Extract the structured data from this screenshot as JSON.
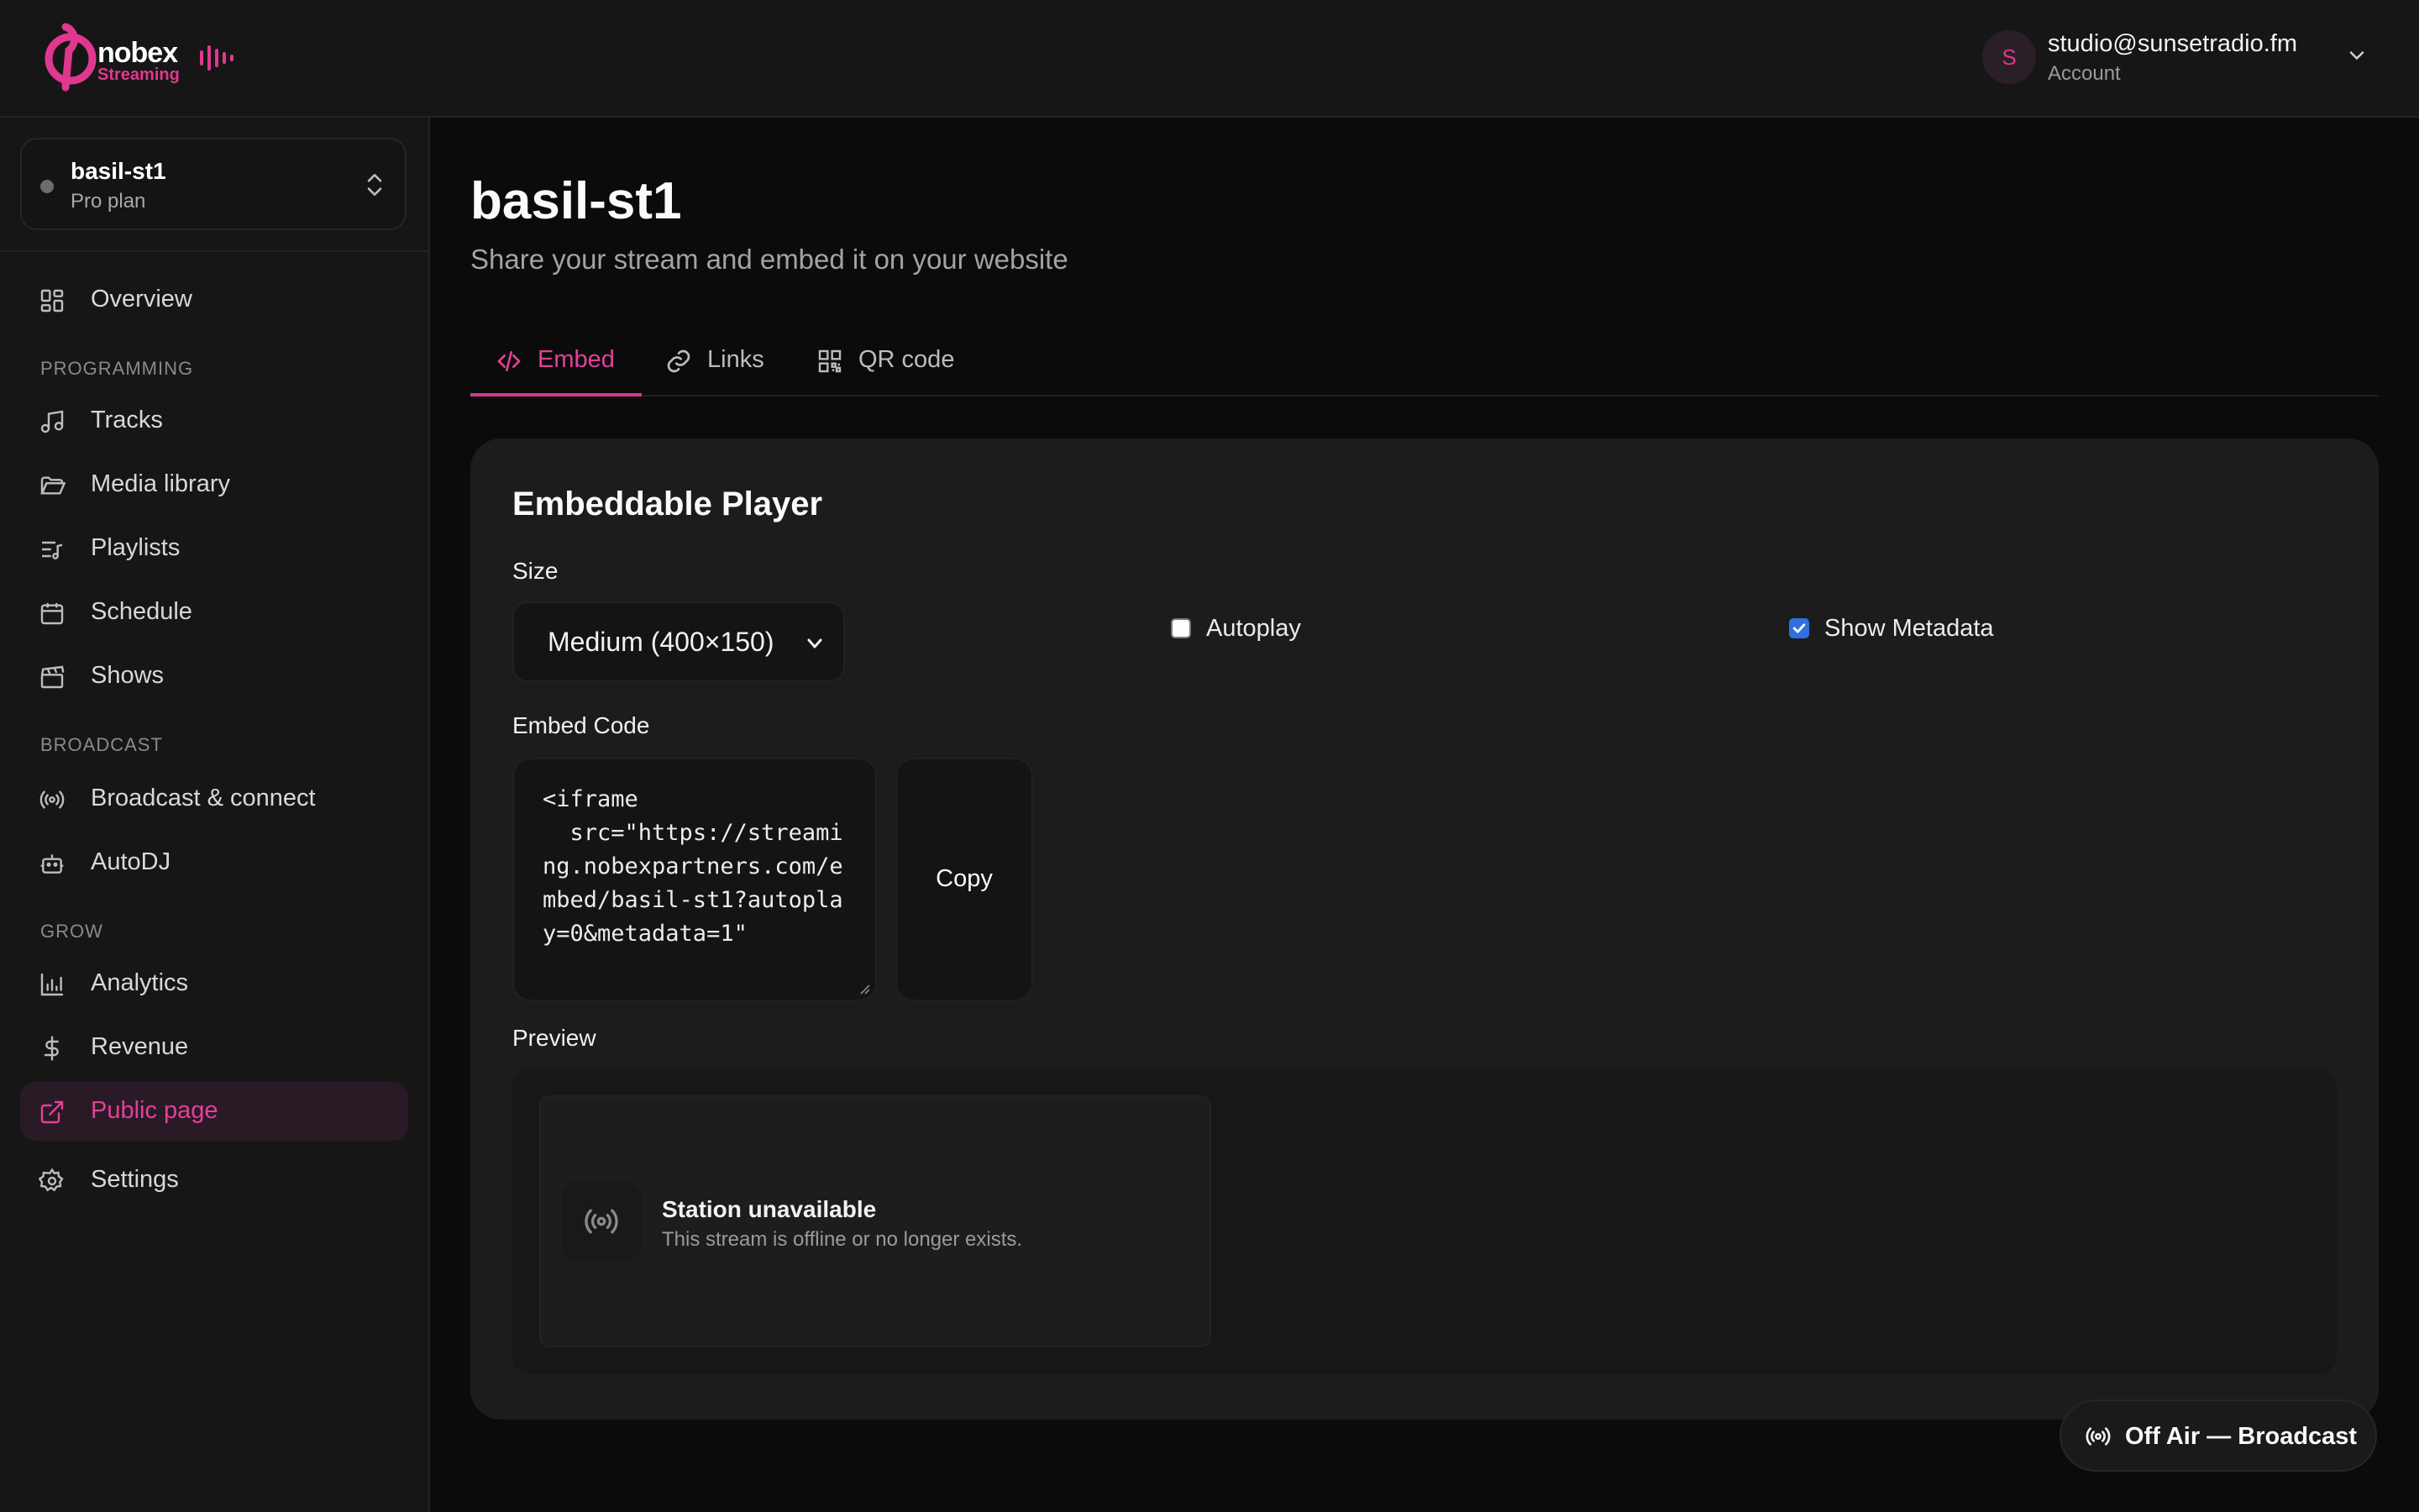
{
  "brand": {
    "name": "nobex",
    "sub": "Streaming",
    "accent": "#e0388f"
  },
  "account": {
    "initial": "S",
    "email": "studio@sunsetradio.fm",
    "label": "Account"
  },
  "station": {
    "name": "basil-st1",
    "plan": "Pro plan"
  },
  "nav": {
    "overview": "Overview",
    "section_programming": "PROGRAMMING",
    "tracks": "Tracks",
    "media_library": "Media library",
    "playlists": "Playlists",
    "schedule": "Schedule",
    "shows": "Shows",
    "section_broadcast": "BROADCAST",
    "broadcast_connect": "Broadcast & connect",
    "autodj": "AutoDJ",
    "section_grow": "GROW",
    "analytics": "Analytics",
    "revenue": "Revenue",
    "public_page": "Public page",
    "settings": "Settings",
    "active": "public_page"
  },
  "page": {
    "title": "basil-st1",
    "subtitle": "Share your stream and embed it on your website"
  },
  "tabs": [
    {
      "label": "Embed",
      "icon": "code-icon",
      "active": true
    },
    {
      "label": "Links",
      "icon": "link-icon",
      "active": false
    },
    {
      "label": "QR code",
      "icon": "qr-code-icon",
      "active": false
    }
  ],
  "embed": {
    "card_title": "Embeddable Player",
    "size_label": "Size",
    "size_value": "Medium (400×150)",
    "autoplay_label": "Autoplay",
    "autoplay_checked": false,
    "metadata_label": "Show Metadata",
    "metadata_checked": true,
    "code_label": "Embed Code",
    "code": "<iframe\n  src=\"https://streaming.nobexpartners.com/embed/basil-st1?autoplay=0&metadata=1\"",
    "copy_label": "Copy",
    "preview_label": "Preview",
    "player_title": "Station unavailable",
    "player_sub": "This stream is offline or no longer exists."
  },
  "status": {
    "label": "Off Air — Broadcast"
  }
}
